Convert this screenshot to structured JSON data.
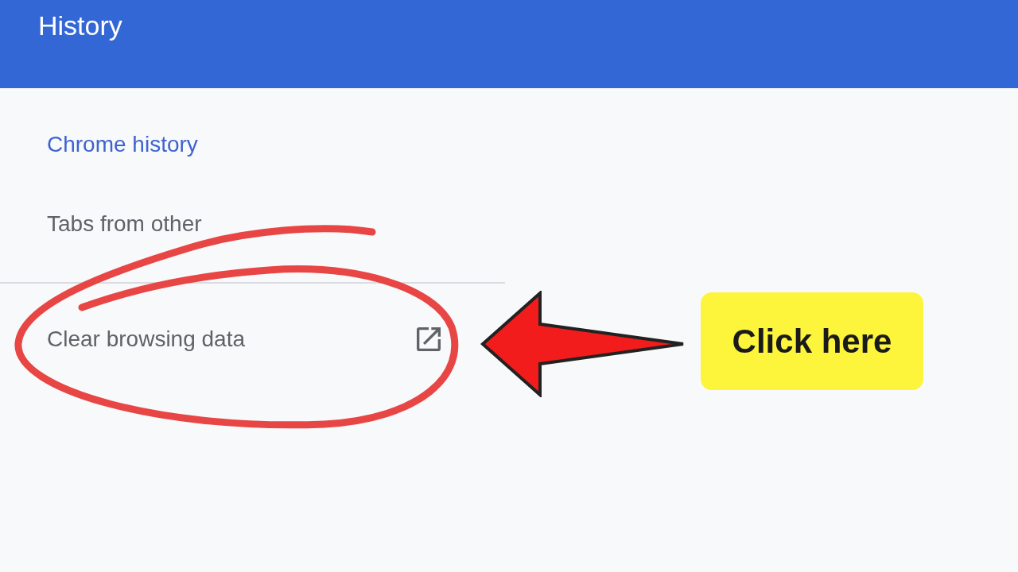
{
  "header": {
    "title": "History"
  },
  "nav": {
    "items": [
      {
        "label": "Chrome history",
        "selected": true
      },
      {
        "label": "Tabs from other",
        "selected": false
      }
    ]
  },
  "clear_data": {
    "label": "Clear browsing data"
  },
  "callout": {
    "text": "Click here"
  }
}
